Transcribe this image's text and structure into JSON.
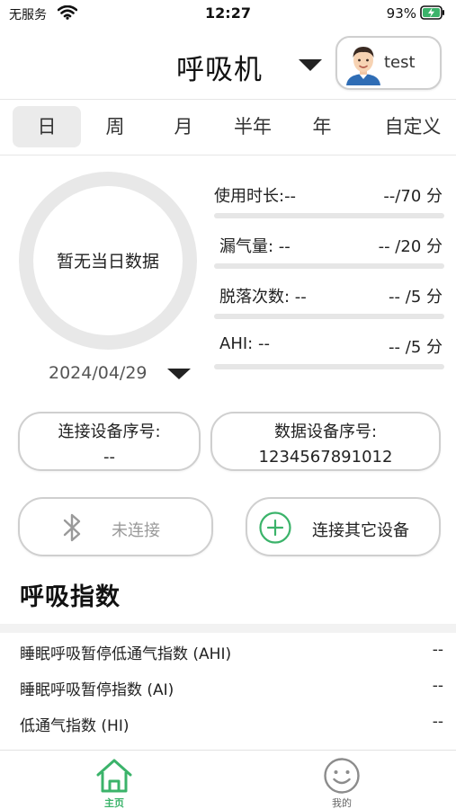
{
  "status_bar": {
    "carrier": "无服务",
    "time": "12:27",
    "battery_percent": "93%",
    "icons": [
      "wifi-icon",
      "battery-charging-icon"
    ]
  },
  "header": {
    "device_title": "呼吸机",
    "user_name": "test",
    "icons": [
      "chevron-down-icon",
      "avatar"
    ]
  },
  "tabs": [
    {
      "label": "日",
      "active": true
    },
    {
      "label": "周",
      "active": false
    },
    {
      "label": "月",
      "active": false
    },
    {
      "label": "半年",
      "active": false
    },
    {
      "label": "年",
      "active": false
    },
    {
      "label": "自定义",
      "active": false
    }
  ],
  "summary": {
    "ring_text": "暂无当日数据",
    "date": "2024/04/29",
    "metrics": [
      {
        "label": "使用时长:--",
        "score": "--/70 分"
      },
      {
        "label": "漏气量: --",
        "score": "-- /20 分"
      },
      {
        "label": "脱落次数: --",
        "score": "-- /5 分"
      },
      {
        "label": "AHI: --",
        "score": "-- /5 分"
      }
    ]
  },
  "serials": {
    "connected_label": "连接设备序号:",
    "connected_value": "--",
    "data_label": "数据设备序号:",
    "data_value": "1234567891012"
  },
  "actions": {
    "bluetooth_status": "未连接",
    "connect_other": "连接其它设备"
  },
  "indices": {
    "title": "呼吸指数",
    "rows": [
      {
        "label": "睡眠呼吸暂停低通气指数 (AHI)",
        "value": "--"
      },
      {
        "label": "睡眠呼吸暂停指数 (AI)",
        "value": "--"
      },
      {
        "label": "低通气指数 (HI)",
        "value": "--"
      }
    ]
  },
  "bottom_nav": [
    {
      "label": "主页",
      "icon": "home-icon",
      "active": true
    },
    {
      "label": "我的",
      "icon": "smiley-icon",
      "active": false
    }
  ],
  "colors": {
    "accent_green": "#3bb36a",
    "muted_gray": "#9a9a9a",
    "bar_track": "#e6e6e6"
  }
}
